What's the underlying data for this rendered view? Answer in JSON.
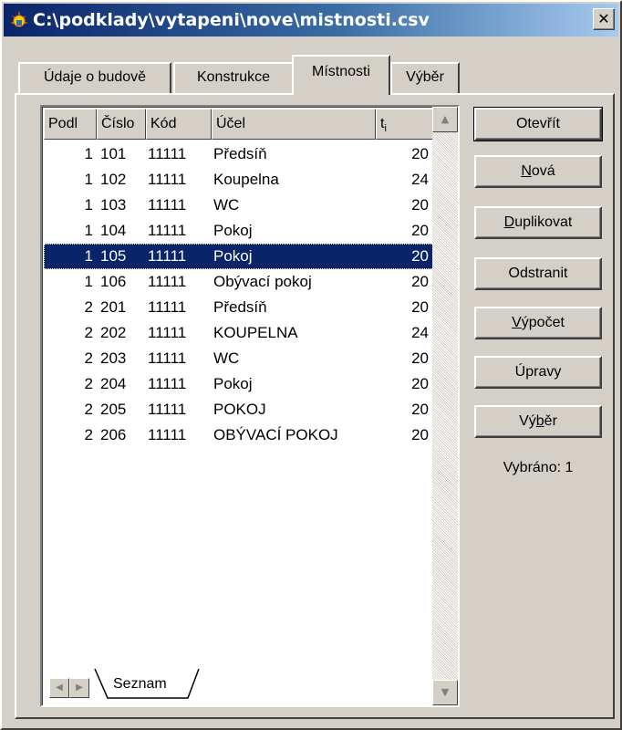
{
  "window": {
    "title": "C:\\podklady\\vytapeni\\nove\\mistnosti.csv",
    "close_glyph": "✕"
  },
  "tabs": [
    {
      "label": "Údaje o budově",
      "active": false
    },
    {
      "label": "Konstrukce",
      "active": false
    },
    {
      "label": "Místnosti",
      "active": true
    },
    {
      "label": "Výběr",
      "active": false
    }
  ],
  "table": {
    "headers": {
      "podl": "Podl",
      "cislo": "Číslo",
      "kod": "Kód",
      "ucel": "Účel",
      "ti": "t",
      "ti_sub": "i"
    },
    "rows": [
      {
        "podl": "1",
        "cislo": "101",
        "kod": "11111",
        "ucel": "Předsíň",
        "ti": "20"
      },
      {
        "podl": "1",
        "cislo": "102",
        "kod": "11111",
        "ucel": "Koupelna",
        "ti": "24"
      },
      {
        "podl": "1",
        "cislo": "103",
        "kod": "11111",
        "ucel": "WC",
        "ti": "20"
      },
      {
        "podl": "1",
        "cislo": "104",
        "kod": "11111",
        "ucel": "Pokoj",
        "ti": "20"
      },
      {
        "podl": "1",
        "cislo": "105",
        "kod": "11111",
        "ucel": "Pokoj",
        "ti": "20",
        "selected": true
      },
      {
        "podl": "1",
        "cislo": "106",
        "kod": "11111",
        "ucel": "Obývací pokoj",
        "ti": "20"
      },
      {
        "podl": "2",
        "cislo": "201",
        "kod": "11111",
        "ucel": "Předsíň",
        "ti": "20"
      },
      {
        "podl": "2",
        "cislo": "202",
        "kod": "11111",
        "ucel": "KOUPELNA",
        "ti": "24"
      },
      {
        "podl": "2",
        "cislo": "203",
        "kod": "11111",
        "ucel": "WC",
        "ti": "20"
      },
      {
        "podl": "2",
        "cislo": "204",
        "kod": "11111",
        "ucel": "Pokoj",
        "ti": "20"
      },
      {
        "podl": "2",
        "cislo": "205",
        "kod": "11111",
        "ucel": "POKOJ",
        "ti": "20"
      },
      {
        "podl": "2",
        "cislo": "206",
        "kod": "11111",
        "ucel": "OBÝVACÍ POKOJ",
        "ti": "20"
      }
    ]
  },
  "sheet_tab": {
    "label": "Seznam"
  },
  "buttons": {
    "otevrit": "Otevřít",
    "nova": {
      "pre": "",
      "ul": "N",
      "post": "ová"
    },
    "duplikovat": {
      "pre": "",
      "ul": "D",
      "post": "uplikovat"
    },
    "odstranit": "Odstranit",
    "vypocet": {
      "pre": "",
      "ul": "V",
      "post": "ýpočet"
    },
    "upravy": "Úpravy",
    "vyber": {
      "pre": "Vý",
      "ul": "b",
      "post": "ěr"
    }
  },
  "status": "Vybráno: 1",
  "colors": {
    "face": "#d4d0c8",
    "selection": "#0a246a",
    "title_start": "#0a246a",
    "title_end": "#a6caf0"
  }
}
